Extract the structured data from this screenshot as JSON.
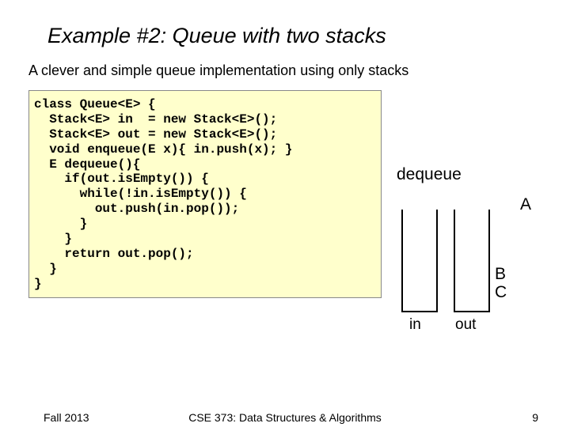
{
  "title": "Example #2: Queue with two stacks",
  "subtitle": "A clever and simple queue implementation using only stacks",
  "code": "class Queue<E> {\n  Stack<E> in  = new Stack<E>();\n  Stack<E> out = new Stack<E>();\n  void enqueue(E x){ in.push(x); }\n  E dequeue(){\n    if(out.isEmpty()) {\n      while(!in.isEmpty()) {\n        out.push(in.pop());\n      }\n    }\n    return out.pop();\n  }\n}",
  "diagram": {
    "action": "dequeue",
    "popped": "A",
    "remaining_top": "B",
    "remaining_bottom": "C",
    "in_label": "in",
    "out_label": "out"
  },
  "footer": {
    "left": "Fall 2013",
    "center": "CSE 373: Data Structures & Algorithms",
    "page": "9"
  }
}
